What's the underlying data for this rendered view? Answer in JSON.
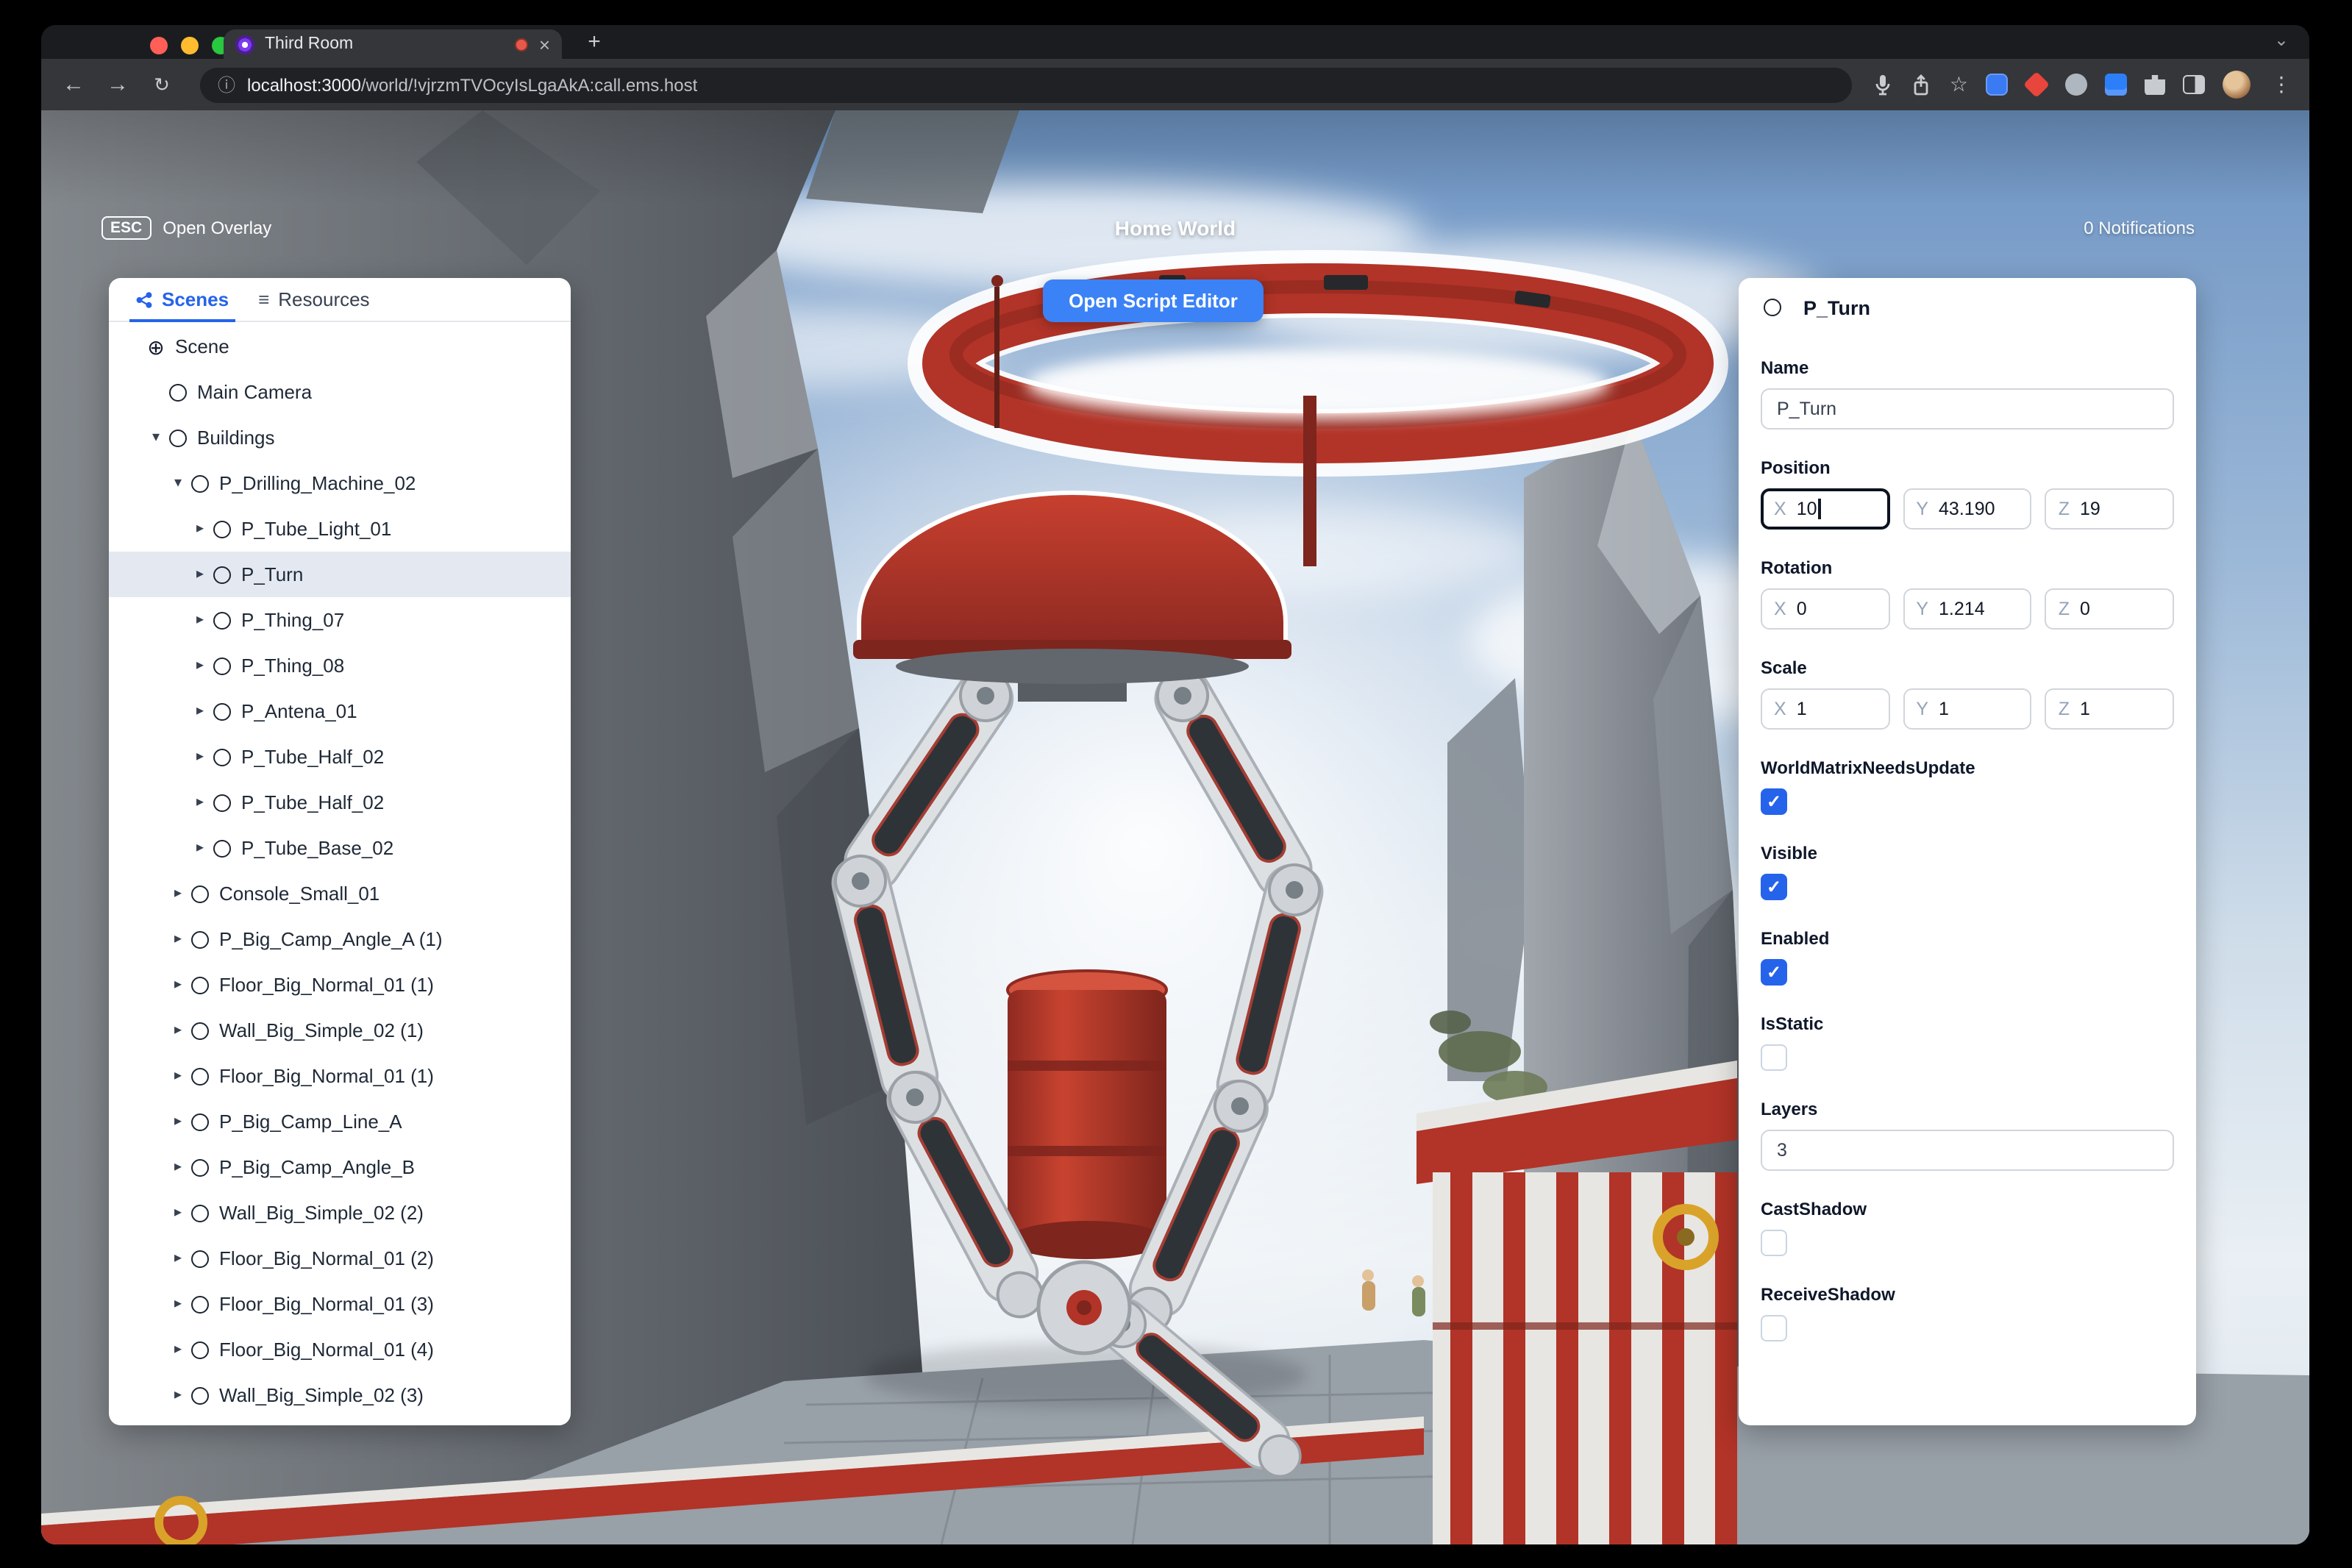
{
  "browser": {
    "tab_title": "Third Room",
    "url_host": "localhost:3000",
    "url_path": "/world/!vjrzmTVOcyIsLgaAkA:call.ems.host"
  },
  "topbar": {
    "esc_key": "ESC",
    "open_overlay_label": "Open Overlay",
    "world_title": "Home World",
    "notifications_label": "0 Notifications",
    "open_script_editor_label": "Open Script Editor"
  },
  "left_panel": {
    "tabs": [
      {
        "label": "Scenes"
      },
      {
        "label": "Resources"
      }
    ],
    "tree": [
      {
        "label": "Scene",
        "depth": 0,
        "icon": "globe",
        "caret": "none"
      },
      {
        "label": "Main Camera",
        "depth": 1,
        "icon": "circle",
        "caret": "none"
      },
      {
        "label": "Buildings",
        "depth": 1,
        "icon": "circle",
        "caret": "down"
      },
      {
        "label": "P_Drilling_Machine_02",
        "depth": 2,
        "icon": "circle",
        "caret": "down"
      },
      {
        "label": "P_Tube_Light_01",
        "depth": 3,
        "icon": "circle",
        "caret": "right"
      },
      {
        "label": "P_Turn",
        "depth": 3,
        "icon": "circle",
        "caret": "right",
        "selected": true
      },
      {
        "label": "P_Thing_07",
        "depth": 3,
        "icon": "circle",
        "caret": "right"
      },
      {
        "label": "P_Thing_08",
        "depth": 3,
        "icon": "circle",
        "caret": "right"
      },
      {
        "label": "P_Antena_01",
        "depth": 3,
        "icon": "circle",
        "caret": "right"
      },
      {
        "label": "P_Tube_Half_02",
        "depth": 3,
        "icon": "circle",
        "caret": "right"
      },
      {
        "label": "P_Tube_Half_02",
        "depth": 3,
        "icon": "circle",
        "caret": "right"
      },
      {
        "label": "P_Tube_Base_02",
        "depth": 3,
        "icon": "circle",
        "caret": "right"
      },
      {
        "label": "Console_Small_01",
        "depth": 2,
        "icon": "circle",
        "caret": "right"
      },
      {
        "label": "P_Big_Camp_Angle_A (1)",
        "depth": 2,
        "icon": "circle",
        "caret": "right"
      },
      {
        "label": "Floor_Big_Normal_01 (1)",
        "depth": 2,
        "icon": "circle",
        "caret": "right"
      },
      {
        "label": "Wall_Big_Simple_02 (1)",
        "depth": 2,
        "icon": "circle",
        "caret": "right"
      },
      {
        "label": "Floor_Big_Normal_01 (1)",
        "depth": 2,
        "icon": "circle",
        "caret": "right"
      },
      {
        "label": "P_Big_Camp_Line_A",
        "depth": 2,
        "icon": "circle",
        "caret": "right"
      },
      {
        "label": "P_Big_Camp_Angle_B",
        "depth": 2,
        "icon": "circle",
        "caret": "right"
      },
      {
        "label": "Wall_Big_Simple_02 (2)",
        "depth": 2,
        "icon": "circle",
        "caret": "right"
      },
      {
        "label": "Floor_Big_Normal_01 (2)",
        "depth": 2,
        "icon": "circle",
        "caret": "right"
      },
      {
        "label": "Floor_Big_Normal_01 (3)",
        "depth": 2,
        "icon": "circle",
        "caret": "right"
      },
      {
        "label": "Floor_Big_Normal_01 (4)",
        "depth": 2,
        "icon": "circle",
        "caret": "right"
      },
      {
        "label": "Wall_Big_Simple_02 (3)",
        "depth": 2,
        "icon": "circle",
        "caret": "right"
      }
    ]
  },
  "inspector": {
    "title": "P_Turn",
    "axis": {
      "x": "X",
      "y": "Y",
      "z": "Z"
    },
    "fields": {
      "name": {
        "label": "Name",
        "value": "P_Turn"
      },
      "position": {
        "label": "Position",
        "x": "10",
        "y": "43.190",
        "z": "19"
      },
      "rotation": {
        "label": "Rotation",
        "x": "0",
        "y": "1.214",
        "z": "0"
      },
      "scale": {
        "label": "Scale",
        "x": "1",
        "y": "1",
        "z": "1"
      },
      "world_matrix_needs_update": {
        "label": "WorldMatrixNeedsUpdate",
        "checked": true
      },
      "visible": {
        "label": "Visible",
        "checked": true
      },
      "enabled": {
        "label": "Enabled",
        "checked": true
      },
      "is_static": {
        "label": "IsStatic",
        "checked": false
      },
      "layers": {
        "label": "Layers",
        "value": "3"
      },
      "cast_shadow": {
        "label": "CastShadow",
        "checked": false
      },
      "receive_shadow": {
        "label": "ReceiveShadow",
        "checked": false
      }
    }
  },
  "icons": {
    "back": "←",
    "forward": "→",
    "reload": "↻",
    "info": "ⓘ",
    "star": "☆",
    "menu": "⋮",
    "close_tab": "×",
    "new_tab": "+",
    "window_chevron": "⌄",
    "caret_down": "▾",
    "caret_right": "▸",
    "check": "✓",
    "globe": "⊕",
    "resources_list": "≡"
  },
  "colors": {
    "accent_blue": "#3b82f6",
    "checkbox_blue": "#2563eb",
    "selection_bg": "#e4e9f1",
    "ring_red": "#b23327"
  }
}
